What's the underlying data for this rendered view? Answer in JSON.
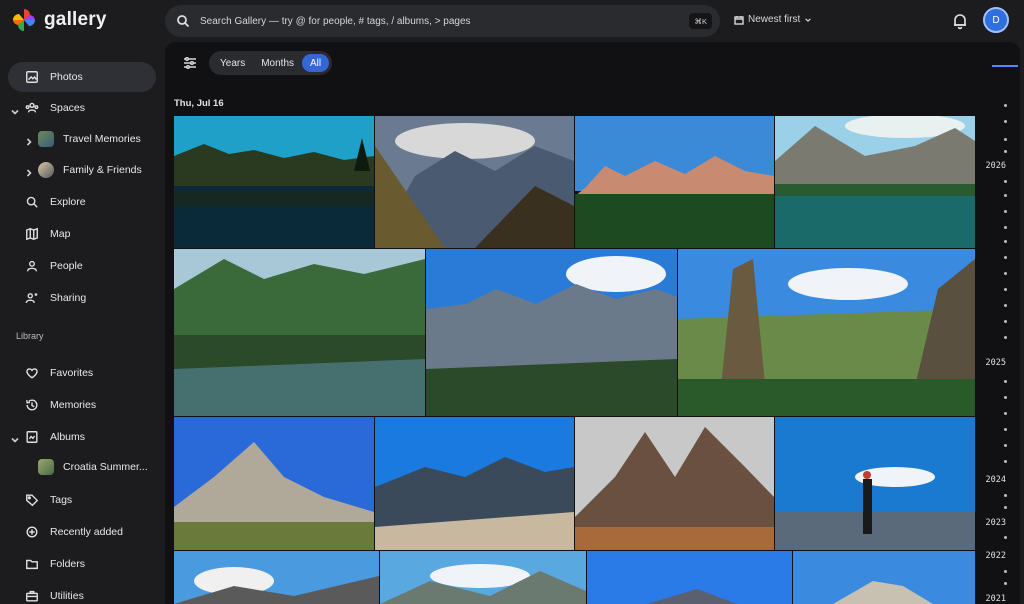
{
  "app": {
    "name": "gallery"
  },
  "search": {
    "placeholder": "Search Gallery — try @ for people, # tags, / albums, > pages",
    "shortcut": "⌘K"
  },
  "sort": {
    "label": "Newest first"
  },
  "user": {
    "initial": "D"
  },
  "sidebar": {
    "items": [
      {
        "label": "Photos",
        "icon": "photo-icon"
      },
      {
        "label": "Spaces",
        "icon": "people-group-icon"
      },
      {
        "label": "Explore",
        "icon": "search-icon"
      },
      {
        "label": "Map",
        "icon": "map-icon"
      },
      {
        "label": "People",
        "icon": "person-icon"
      },
      {
        "label": "Sharing",
        "icon": "share-people-icon"
      },
      {
        "label": "Favorites",
        "icon": "heart-icon"
      },
      {
        "label": "Memories",
        "icon": "history-icon"
      },
      {
        "label": "Albums",
        "icon": "album-icon"
      },
      {
        "label": "Tags",
        "icon": "tag-icon"
      },
      {
        "label": "Recently added",
        "icon": "add-circle-icon"
      },
      {
        "label": "Folders",
        "icon": "folder-icon"
      },
      {
        "label": "Utilities",
        "icon": "briefcase-icon"
      }
    ],
    "spaces": [
      {
        "label": "Travel Memories"
      },
      {
        "label": "Family & Friends"
      }
    ],
    "albums": [
      {
        "label": "Croatia Summer..."
      }
    ],
    "library_label": "Library"
  },
  "view": {
    "modes": [
      "Years",
      "Months",
      "All"
    ],
    "active_mode": "All"
  },
  "timeline": {
    "group_date": "Thu, Jul 16",
    "years": [
      "2026",
      "2025",
      "2024",
      "2023",
      "2022",
      "2021"
    ]
  },
  "colors": {
    "accent": "#3566d6",
    "avatar": "#2f6fe0"
  }
}
